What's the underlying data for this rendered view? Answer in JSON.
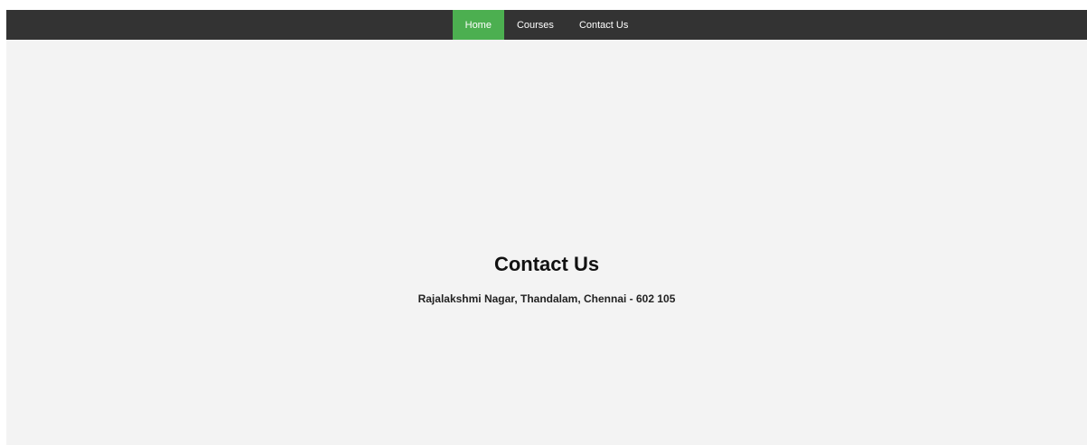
{
  "nav": {
    "items": [
      {
        "label": "Home",
        "active": true
      },
      {
        "label": "Courses",
        "active": false
      },
      {
        "label": "Contact Us",
        "active": false
      }
    ]
  },
  "main": {
    "title": "Contact Us",
    "address": "Rajalakshmi Nagar, Thandalam, Chennai - 602 105"
  },
  "colors": {
    "navbar_bg": "#333333",
    "active_item": "#4caf50",
    "page_bg": "#f3f3f3"
  }
}
